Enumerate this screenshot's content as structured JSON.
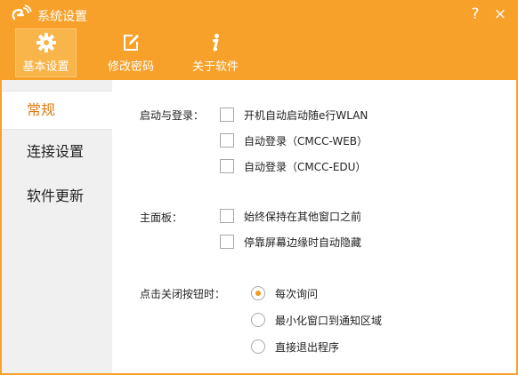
{
  "window": {
    "title": "系统设置",
    "help_glyph": "?",
    "close_glyph": "×"
  },
  "nav": {
    "tabs": [
      {
        "label": "基本设置",
        "icon": "gear-icon",
        "active": true
      },
      {
        "label": "修改密码",
        "icon": "edit-icon",
        "active": false
      },
      {
        "label": "关于软件",
        "icon": "info-icon",
        "active": false
      }
    ]
  },
  "sidebar": {
    "items": [
      {
        "label": "常规",
        "active": true
      },
      {
        "label": "连接设置",
        "active": false
      },
      {
        "label": "软件更新",
        "active": false
      }
    ]
  },
  "startup": {
    "label": "启动与登录：",
    "options": [
      {
        "label": "开机自动启动随e行WLAN",
        "checked": false
      },
      {
        "label": "自动登录（CMCC-WEB）",
        "checked": false
      },
      {
        "label": "自动登录（CMCC-EDU）",
        "checked": false
      }
    ]
  },
  "panel": {
    "label": "主面板：",
    "options": [
      {
        "label": "始终保持在其他窗口之前",
        "checked": false
      },
      {
        "label": "停靠屏幕边缘时自动隐藏",
        "checked": false
      }
    ]
  },
  "close_action": {
    "label": "点击关闭按钮时：",
    "options": [
      {
        "label": "每次询问",
        "selected": true
      },
      {
        "label": "最小化窗口到通知区域",
        "selected": false
      },
      {
        "label": "直接退出程序",
        "selected": false
      }
    ]
  },
  "colors": {
    "accent": "#f7a12a",
    "highlight": "#e07a10",
    "radio_dot": "#f39a1b"
  }
}
